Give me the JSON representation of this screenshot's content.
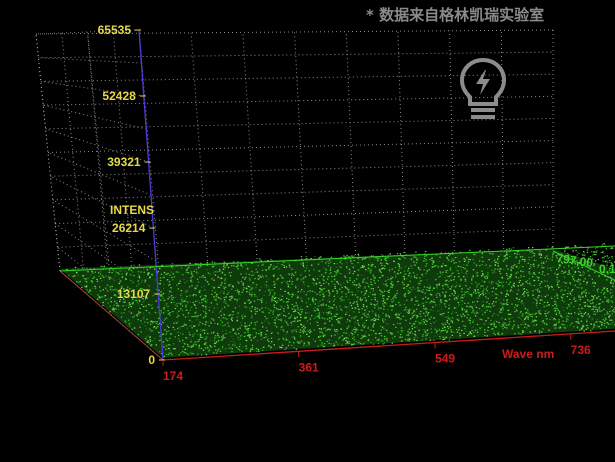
{
  "watermark": "* 数据来自格林凯瑞实验室",
  "icons": {
    "hint": "lightbulb-icon"
  },
  "colors": {
    "background": "#000000",
    "grid": "#bdbdbd",
    "y_tick_text": "#e8d84a",
    "x_tick_text": "#cc1b1b",
    "data": "#3bd42a",
    "z_axis": "#4a3bd8"
  },
  "chart_data": {
    "type": "area",
    "title": "",
    "xlabel": "Wave nm",
    "ylabel": "INTENS",
    "ylim": [
      0,
      65535
    ],
    "xlim": [
      174,
      797
    ],
    "yticks": [
      "65535",
      "52428",
      "39321",
      "26214",
      "13107",
      "0"
    ],
    "xticks": [
      "174",
      "361",
      "549",
      "736"
    ],
    "depth_ticks": [
      "797.00",
      "0.1"
    ],
    "grid": true,
    "series": [
      {
        "x": [
          174,
          361,
          549,
          736,
          797
        ],
        "values": [
          450,
          450,
          450,
          450,
          450
        ]
      }
    ]
  }
}
